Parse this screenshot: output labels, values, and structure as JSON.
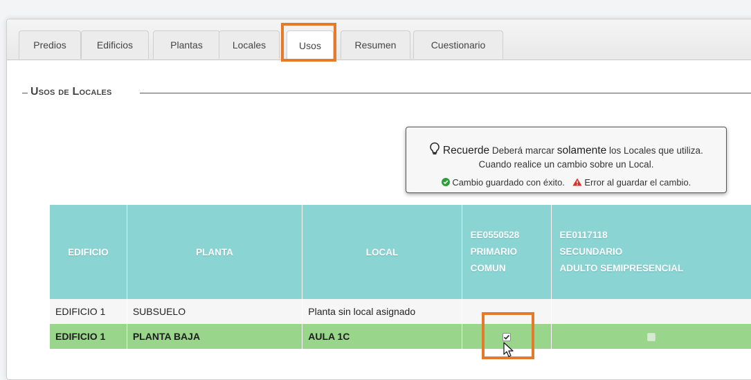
{
  "tabs": [
    {
      "label": "Predios",
      "active": false
    },
    {
      "label": "Edificios",
      "active": false
    },
    {
      "label": "Plantas",
      "active": false
    },
    {
      "label": "Locales",
      "active": false
    },
    {
      "label": "Usos",
      "active": true
    },
    {
      "label": "Resumen",
      "active": false
    },
    {
      "label": "Cuestionario",
      "active": false
    }
  ],
  "section_title": "Usos de Locales",
  "tip": {
    "recuerde": "Recuerde",
    "line1_a": "Deberá marcar",
    "line1_strong": "solamente",
    "line1_b": "los Locales que utiliza.",
    "line2": "Cuando realice un cambio sobre un Local.",
    "ok_text": "Cambio guardado con éxito.",
    "error_text": "Error al guardar el cambio."
  },
  "table": {
    "headers": {
      "edificio": "EDIFICIO",
      "planta": "PLANTA",
      "local": "LOCAL",
      "col1": [
        "EE0550528",
        "PRIMARIO",
        "COMUN"
      ],
      "col2": [
        "EE0117118",
        "SECUNDARIO",
        "ADULTO SEMIPRESENCIAL"
      ]
    },
    "rows": [
      {
        "edificio": "EDIFICIO 1",
        "planta": "SUBSUELO",
        "local": "Planta sin local asignado"
      },
      {
        "edificio": "EDIFICIO 1",
        "planta": "PLANTA BAJA",
        "local": "AULA 1C",
        "col1_checked": true,
        "col2_checked": false
      }
    ]
  },
  "colors": {
    "highlight": "#e57a2a",
    "header_bg": "#8ad4d3",
    "selected_row": "#99d58b",
    "success": "#2e9e3a",
    "error": "#d9302a"
  },
  "icons": [
    "lightbulb-icon",
    "check-circle-icon",
    "warning-icon",
    "mouse-cursor-icon",
    "checkbox-icon"
  ]
}
